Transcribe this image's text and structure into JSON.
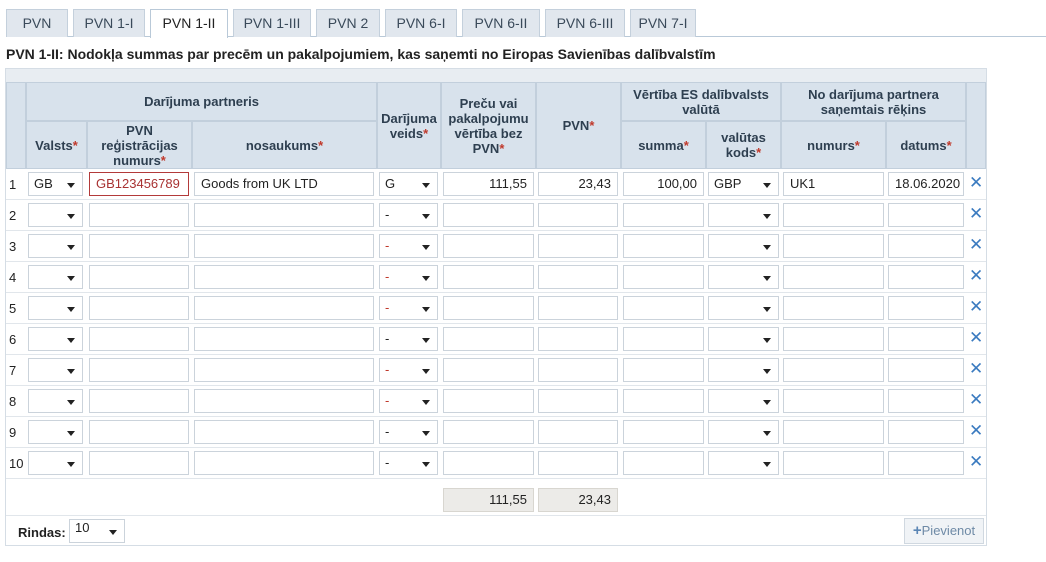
{
  "tabs": [
    "PVN",
    "PVN 1-I",
    "PVN 1-II",
    "PVN 1-III",
    "PVN 2",
    "PVN 6-I",
    "PVN 6-II",
    "PVN 6-III",
    "PVN 7-I"
  ],
  "active_tab": "PVN 1-II",
  "page_title": "PVN 1-II: Nodokļa summas par precēm un pakalpojumiem, kas saņemti no Eiropas Savienības dalībvalstīm",
  "headers": {
    "partner_group": "Darījuma partneris",
    "country": "Valsts",
    "vat_reg": "PVN reģistrācijas numurs",
    "name": "nosaukums",
    "deal_type": "Darījuma veids",
    "goods_value": "Preču vai pakalpojumu vērtība bez PVN",
    "vat": "PVN",
    "eu_value_group": "Vērtība ES dalībvalsts valūtā",
    "amount": "summa",
    "currency": "valūtas kods",
    "invoice_group": "No darījuma partnera saņemtais rēķins",
    "invoice_number": "numurs",
    "invoice_date": "datums",
    "required_mark": "*"
  },
  "rows": [
    {
      "num": "1",
      "country": "GB",
      "vat_reg": "GB123456789",
      "name": "Goods from UK LTD",
      "deal_type": "G",
      "goods_value": "111,55",
      "vat": "23,43",
      "amount": "100,00",
      "currency": "GBP",
      "invoice_number": "UK1",
      "invoice_date": "18.06.2020"
    },
    {
      "num": "2",
      "country": "",
      "vat_reg": "",
      "name": "",
      "deal_type": "-",
      "goods_value": "",
      "vat": "",
      "amount": "",
      "currency": "",
      "invoice_number": "",
      "invoice_date": ""
    },
    {
      "num": "3",
      "country": "",
      "vat_reg": "",
      "name": "",
      "deal_type": "-",
      "goods_value": "",
      "vat": "",
      "amount": "",
      "currency": "",
      "invoice_number": "",
      "invoice_date": ""
    },
    {
      "num": "4",
      "country": "",
      "vat_reg": "",
      "name": "",
      "deal_type": "-",
      "goods_value": "",
      "vat": "",
      "amount": "",
      "currency": "",
      "invoice_number": "",
      "invoice_date": ""
    },
    {
      "num": "5",
      "country": "",
      "vat_reg": "",
      "name": "",
      "deal_type": "-",
      "goods_value": "",
      "vat": "",
      "amount": "",
      "currency": "",
      "invoice_number": "",
      "invoice_date": ""
    },
    {
      "num": "6",
      "country": "",
      "vat_reg": "",
      "name": "",
      "deal_type": "-",
      "goods_value": "",
      "vat": "",
      "amount": "",
      "currency": "",
      "invoice_number": "",
      "invoice_date": ""
    },
    {
      "num": "7",
      "country": "",
      "vat_reg": "",
      "name": "",
      "deal_type": "-",
      "goods_value": "",
      "vat": "",
      "amount": "",
      "currency": "",
      "invoice_number": "",
      "invoice_date": ""
    },
    {
      "num": "8",
      "country": "",
      "vat_reg": "",
      "name": "",
      "deal_type": "-",
      "goods_value": "",
      "vat": "",
      "amount": "",
      "currency": "",
      "invoice_number": "",
      "invoice_date": ""
    },
    {
      "num": "9",
      "country": "",
      "vat_reg": "",
      "name": "",
      "deal_type": "-",
      "goods_value": "",
      "vat": "",
      "amount": "",
      "currency": "",
      "invoice_number": "",
      "invoice_date": ""
    },
    {
      "num": "10",
      "country": "",
      "vat_reg": "",
      "name": "",
      "deal_type": "-",
      "goods_value": "",
      "vat": "",
      "amount": "",
      "currency": "",
      "invoice_number": "",
      "invoice_date": ""
    }
  ],
  "red_dash_rows": [
    "3",
    "4",
    "5",
    "7",
    "8"
  ],
  "totals": {
    "goods_value": "111,55",
    "vat": "23,43"
  },
  "footer": {
    "rows_label": "Rindas:",
    "rows_value": "10",
    "add_label": "Pievienot"
  },
  "icons": {
    "delete": "close-icon",
    "dropdown": "chevron-down-icon",
    "add": "plus-icon"
  },
  "colors": {
    "header_bg": "#d8e2ec",
    "required": "#c0392b",
    "delete_icon": "#3b7bc0",
    "error_border": "#b33a3a"
  }
}
